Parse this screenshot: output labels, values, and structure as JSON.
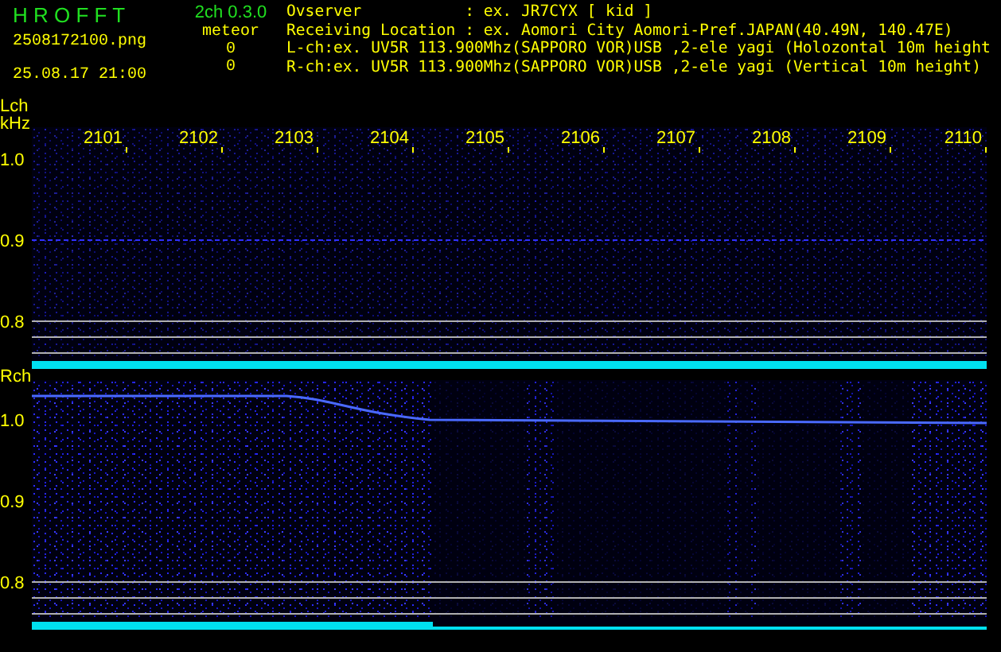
{
  "header": {
    "app_name": "H R O F F T",
    "version": "2ch 0.3.0",
    "file_name": "2508172100.png",
    "timestamp": "25.08.17 21:00",
    "meteor_label": "meteor",
    "meteor_counts": [
      "0",
      "0"
    ],
    "info": [
      "Ovserver           : ex. JR7CYX [ kid ]",
      "Receiving Location : ex. Aomori City Aomori-Pref.JAPAN(40.49N, 140.47E)",
      "L-ch:ex. UV5R 113.900Mhz(SAPPORO VOR)USB ,2-ele yagi (Holozontal 10m height",
      "R-ch:ex. UV5R 113.900Mhz(SAPPORO VOR)USB ,2-ele yagi (Vertical 10m height)"
    ]
  },
  "channels": [
    {
      "name": "Lch",
      "unit": "kHz",
      "yticks": [
        "1.0",
        "0.9",
        "0.8"
      ],
      "time_labels": [
        "2101",
        "2102",
        "2103",
        "2104",
        "2105",
        "2106",
        "2107",
        "2108",
        "2109",
        "2110"
      ]
    },
    {
      "name": "Rch",
      "yticks": [
        "1.0",
        "0.9",
        "0.8"
      ]
    }
  ]
}
